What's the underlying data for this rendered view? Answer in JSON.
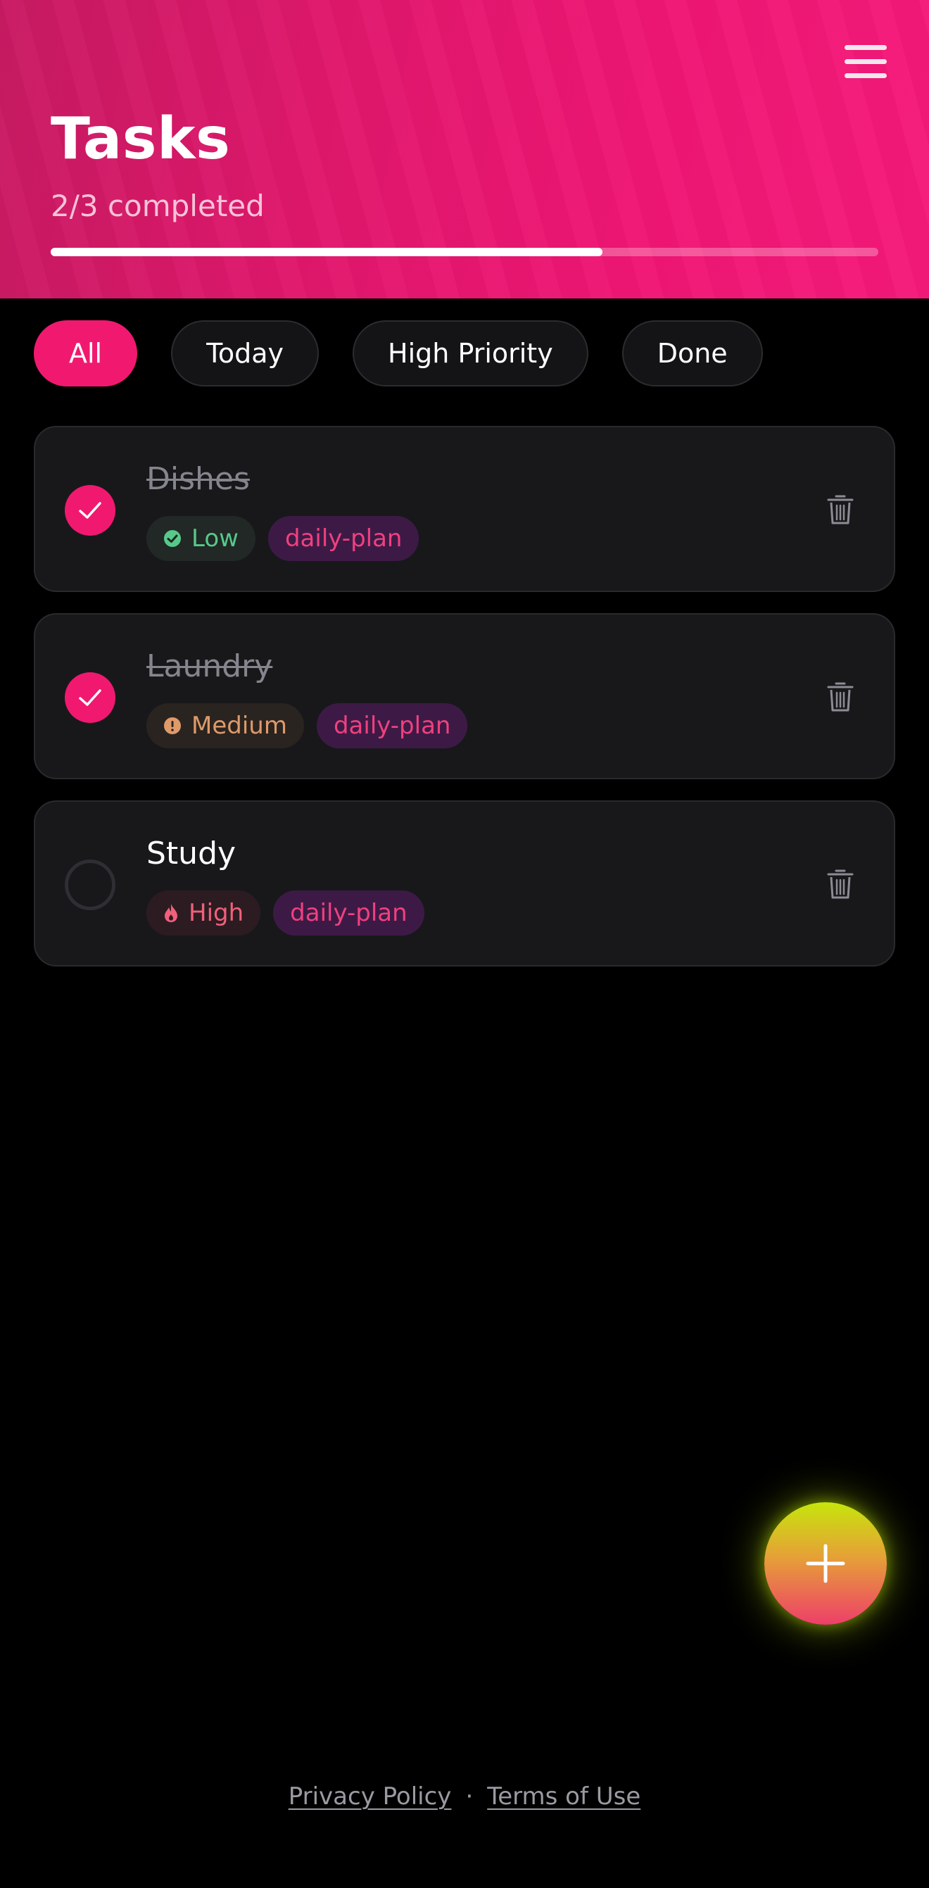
{
  "header": {
    "title": "Tasks",
    "subtitle": "2/3 completed",
    "progress": 0.667,
    "menu_icon": "hamburger-menu-icon"
  },
  "filters": [
    {
      "label": "All",
      "active": true
    },
    {
      "label": "Today",
      "active": false
    },
    {
      "label": "High Priority",
      "active": false
    },
    {
      "label": "Done",
      "active": false
    }
  ],
  "tasks": [
    {
      "name": "Dishes",
      "done": true,
      "priority": "Low",
      "priority_icon": "check-circle-icon",
      "tag": "daily-plan"
    },
    {
      "name": "Laundry",
      "done": true,
      "priority": "Medium",
      "priority_icon": "alert-circle-icon",
      "tag": "daily-plan"
    },
    {
      "name": "Study",
      "done": false,
      "priority": "High",
      "priority_icon": "flame-icon",
      "tag": "daily-plan"
    }
  ],
  "fab": {
    "icon": "plus-icon"
  },
  "footer": {
    "privacy": "Privacy Policy",
    "separator": "·",
    "terms": "Terms of Use"
  },
  "colors": {
    "accent": "#f0196f",
    "background": "#000000",
    "card": "#18181b",
    "low": "#56c98a",
    "medium": "#df9a6a",
    "high": "#f0607a",
    "tag": "#f0407f"
  }
}
